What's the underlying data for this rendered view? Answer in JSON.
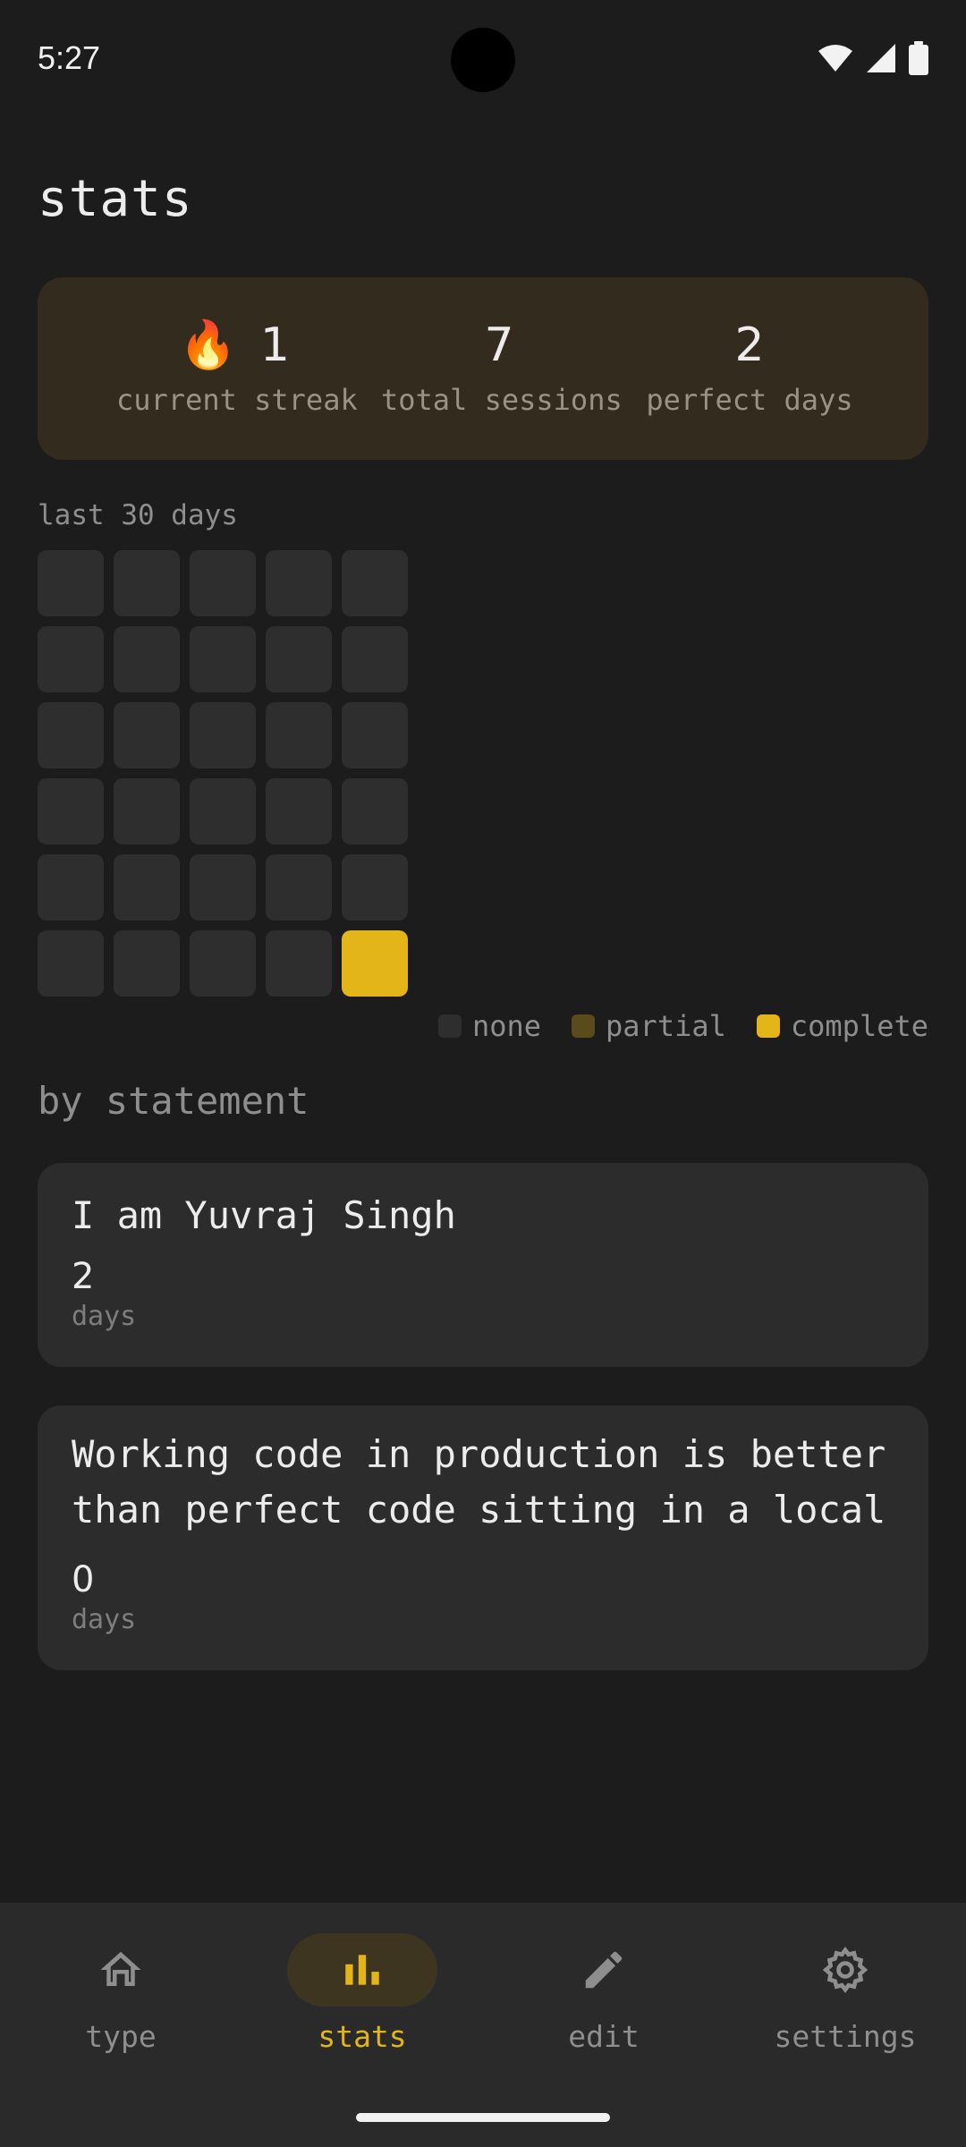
{
  "status_bar": {
    "time": "5:27"
  },
  "page": {
    "title": "stats"
  },
  "summary": {
    "streak": {
      "value": "1",
      "label": "current streak"
    },
    "sessions": {
      "value": "7",
      "label": "total sessions"
    },
    "perfect": {
      "value": "2",
      "label": "perfect days"
    }
  },
  "history": {
    "label": "last 30 days",
    "days": [
      "none",
      "none",
      "none",
      "none",
      "none",
      "none",
      "none",
      "none",
      "none",
      "none",
      "none",
      "none",
      "none",
      "none",
      "none",
      "none",
      "none",
      "none",
      "none",
      "none",
      "none",
      "none",
      "none",
      "none",
      "none",
      "none",
      "none",
      "none",
      "none",
      "complete"
    ],
    "colors": {
      "none": "#2e2e2e",
      "partial": "#5a4a1c",
      "complete": "#e3b519"
    }
  },
  "legend": {
    "none": "none",
    "partial": "partial",
    "complete": "complete"
  },
  "statements": {
    "heading": "by statement",
    "items": [
      {
        "text": "I am Yuvraj Singh",
        "count": "2",
        "unit": "days"
      },
      {
        "text": "Working code in production is better\nthan perfect code sitting in a local",
        "count": "0",
        "unit": "days"
      }
    ]
  },
  "nav": {
    "type": "type",
    "stats": "stats",
    "edit": "edit",
    "settings": "settings",
    "active": "stats"
  },
  "colors": {
    "accent": "#e3b519",
    "background": "#1c1c1c",
    "card": "#2c2c2c",
    "summary_card": "#322b1e"
  }
}
